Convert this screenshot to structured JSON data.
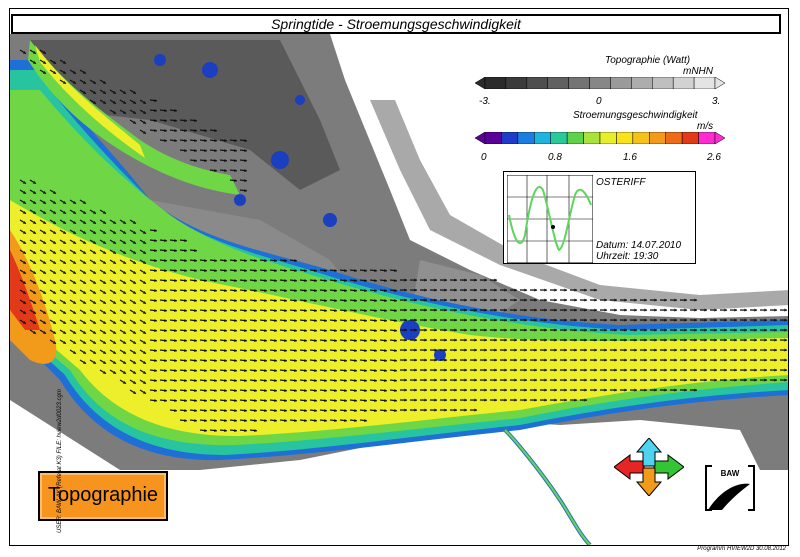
{
  "title": "Springtide - Stroemungsgeschwindigkeit",
  "topo_legend": {
    "title": "Topographie (Watt)",
    "unit": "mNHN",
    "ticks": [
      "-3.",
      "0",
      "3."
    ],
    "colors": [
      "#2b2b2b",
      "#3b3b3b",
      "#4e4e4e",
      "#616161",
      "#747474",
      "#878787",
      "#9a9a9a",
      "#adadad",
      "#bfbfbf",
      "#d2d2d2",
      "#e4e4e4"
    ]
  },
  "speed_legend": {
    "title": "Stroemungsgeschwindigkeit",
    "unit": "m/s",
    "ticks": [
      "0",
      "0.8",
      "1.6",
      "2.6"
    ],
    "colors": [
      "#5b0099",
      "#1f3cc8",
      "#1c7de0",
      "#1fb3e0",
      "#2ac99a",
      "#5fd24a",
      "#a8e23a",
      "#e6ef2a",
      "#f7e21c",
      "#f5c21a",
      "#f29a1a",
      "#ee6b1a",
      "#e23a18",
      "#ff2ad0"
    ]
  },
  "inset": {
    "station": "OSTERIFF",
    "date": "Datum: 14.07.2010",
    "time": "Uhrzeit: 19:30"
  },
  "topo_button": "Topographie",
  "side_text": "USER: BAW-AK (Referat K3)   FILE: hview2d0023.cgm",
  "footer": "Programm HVIEW2D   30.08.2012",
  "logo_text": "BAW"
}
